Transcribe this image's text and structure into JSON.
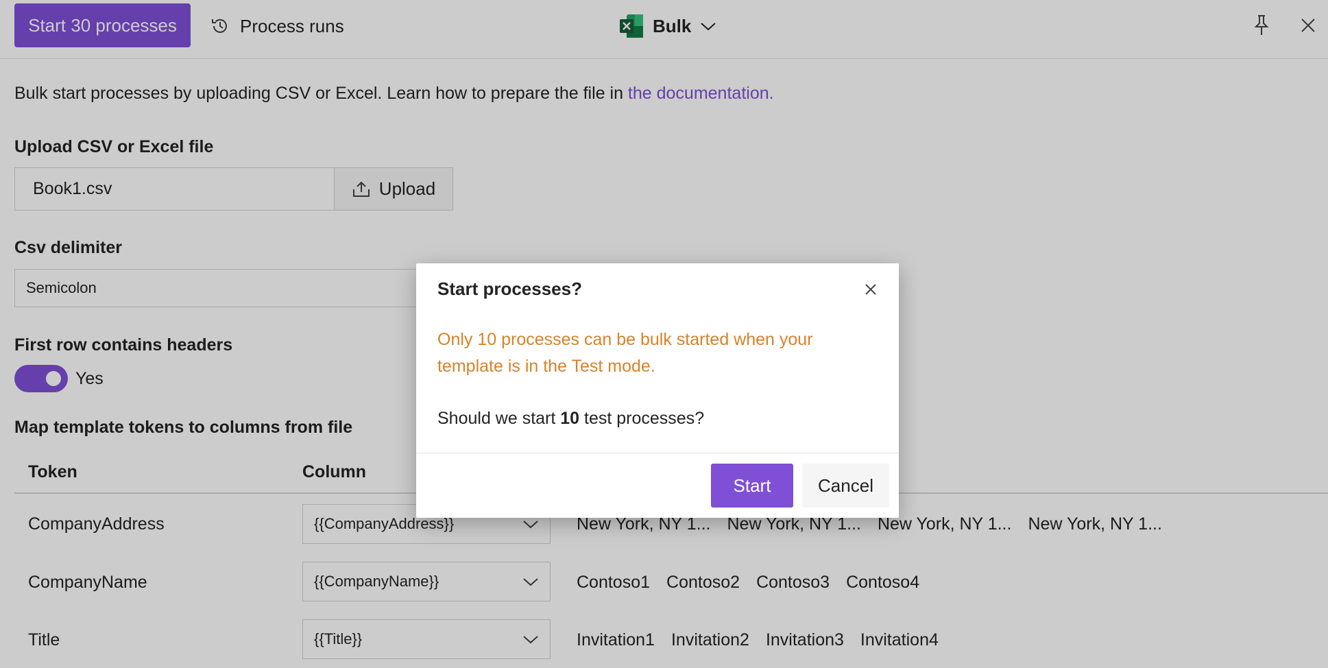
{
  "header": {
    "start_button": "Start 30 processes",
    "process_runs": "Process runs",
    "bulk_label": "Bulk"
  },
  "intro": {
    "text": "Bulk start processes by uploading CSV or Excel. Learn how to prepare the file in ",
    "link": "the documentation."
  },
  "upload": {
    "label": "Upload CSV or Excel file",
    "file_name": "Book1.csv",
    "button": "Upload"
  },
  "delimiter": {
    "label": "Csv delimiter",
    "value": "Semicolon"
  },
  "headers_toggle": {
    "label": "First row contains headers",
    "value": "Yes",
    "on": true
  },
  "mapping": {
    "label": "Map template tokens to columns from file",
    "col_token": "Token",
    "col_column": "Column",
    "rows": [
      {
        "token": "CompanyAddress",
        "column": "{{CompanyAddress}}",
        "samples": [
          "New York, NY 1...",
          "New York, NY 1...",
          "New York, NY 1...",
          "New York, NY 1..."
        ]
      },
      {
        "token": "CompanyName",
        "column": "{{CompanyName}}",
        "samples": [
          "Contoso1",
          "Contoso2",
          "Contoso3",
          "Contoso4"
        ]
      },
      {
        "token": "Title",
        "column": "{{Title}}",
        "samples": [
          "Invitation1",
          "Invitation2",
          "Invitation3",
          "Invitation4"
        ]
      }
    ]
  },
  "dialog": {
    "title": "Start processes?",
    "warning": "Only 10 processes can be bulk started when your template is in the Test mode.",
    "question_prefix": "Should we start ",
    "question_count": "10",
    "question_suffix": " test processes?",
    "start": "Start",
    "cancel": "Cancel"
  },
  "colors": {
    "accent": "#7f4fd6",
    "warning": "#d8822b",
    "excel_green": "#1d6f42"
  },
  "icons": [
    "history-icon",
    "excel-icon",
    "chevron-down-icon",
    "pin-icon",
    "close-icon",
    "upload-icon"
  ]
}
